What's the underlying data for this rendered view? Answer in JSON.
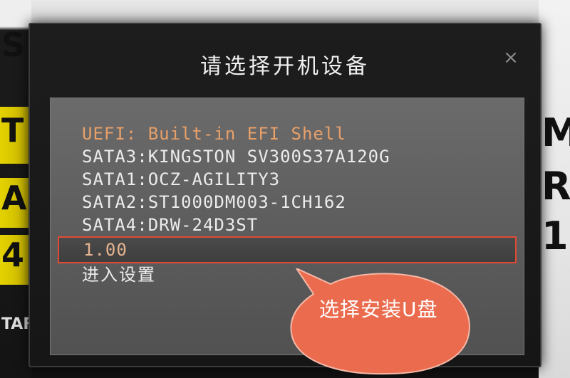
{
  "dialog": {
    "title": "请选择开机设备",
    "close_glyph": "×"
  },
  "boot_menu": {
    "items": [
      "UEFI: Built-in EFI Shell",
      "SATA3:KINGSTON SV300S37A120G",
      "SATA1:OCZ-AGILITY3",
      "SATA2:ST1000DM003-1CH162",
      "SATA4:DRW-24D3ST",
      "1.00",
      "进入设置"
    ],
    "selected_index": 5
  },
  "annotation": {
    "text": "选择安装U盘",
    "border_color": "#e04a35",
    "fill_color": "#ea6b4d"
  },
  "background": {
    "left_marks": [
      "S",
      "T",
      "A",
      "4",
      "TAF"
    ],
    "right_marks": [
      "M",
      "R",
      "1"
    ]
  },
  "colors": {
    "dialog_bg": "#161616",
    "panel_bg": "#5c5c5c",
    "highlight_text": "#e8a069",
    "normal_text": "#ececec",
    "selection_border": "#e04a35"
  }
}
